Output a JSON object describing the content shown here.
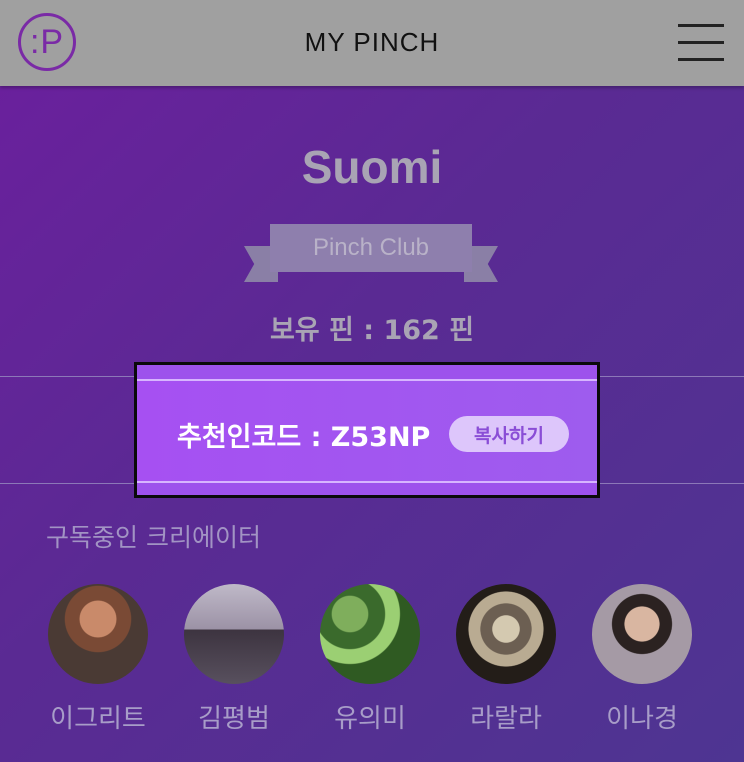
{
  "header": {
    "logo_text": ":P",
    "title": "MY PINCH"
  },
  "profile": {
    "username": "Suomi",
    "membership_badge": "Pinch Club",
    "pins_text": "보유 핀 : 162 핀"
  },
  "referral": {
    "code_text": "추천인코드 : Z53NP",
    "copy_label": "복사하기"
  },
  "creators": {
    "title": "구독중인 크리에이터",
    "items": [
      {
        "name": "이그리트"
      },
      {
        "name": "김평범"
      },
      {
        "name": "유의미"
      },
      {
        "name": "라랄라"
      },
      {
        "name": "이나경"
      }
    ]
  },
  "colors": {
    "header_bg": "#a0a0a0",
    "brand_purple": "#7a2aa6",
    "referral_bg": "#9d52ec",
    "copy_button_bg": "#ddc6fb"
  }
}
